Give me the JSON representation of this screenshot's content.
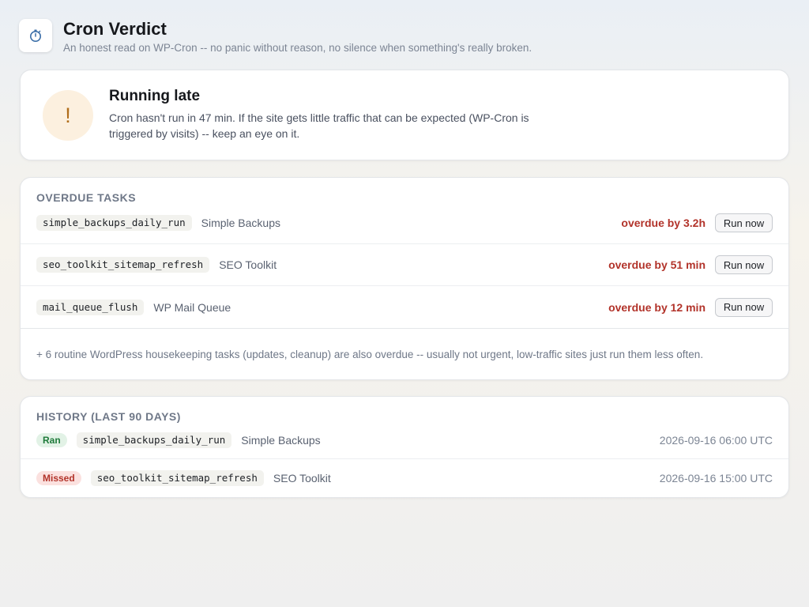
{
  "app": {
    "icon": "stopwatch-icon",
    "title": "Cron Verdict",
    "subtitle": "An honest read on WP-Cron -- no panic without reason, no silence when something's really broken."
  },
  "status": {
    "icon_glyph": "!",
    "title": "Running late",
    "message": "Cron hasn't run in 47 min. If the site gets little traffic that can be expected (WP-Cron is triggered by visits) -- keep an eye on it.",
    "accent": "#b06d1a"
  },
  "overdue": {
    "heading": "Overdue tasks",
    "tasks": [
      {
        "hook": "simple_backups_daily_run",
        "plugin": "Simple Backups",
        "overdue": "overdue by 3.2h",
        "action": "Run now"
      },
      {
        "hook": "seo_toolkit_sitemap_refresh",
        "plugin": "SEO Toolkit",
        "overdue": "overdue by 51 min",
        "action": "Run now"
      },
      {
        "hook": "mail_queue_flush",
        "plugin": "WP Mail Queue",
        "overdue": "overdue by 12 min",
        "action": "Run now"
      }
    ],
    "footnote": "+ 6 routine WordPress housekeeping tasks (updates, cleanup) are also overdue -- usually not urgent, low-traffic sites just run them less often."
  },
  "history": {
    "heading": "History (last 90 days)",
    "items": [
      {
        "status": "Ran",
        "hook": "simple_backups_daily_run",
        "plugin": "Simple Backups",
        "time": "2026-09-16 06:00 UTC"
      },
      {
        "status": "Missed",
        "hook": "seo_toolkit_sitemap_refresh",
        "plugin": "SEO Toolkit",
        "time": "2026-09-16 15:00 UTC"
      }
    ]
  },
  "colors": {
    "overdue_red": "#b2332a",
    "ran_green": "#1e7a3a",
    "warning_bg": "#fcf0df"
  }
}
